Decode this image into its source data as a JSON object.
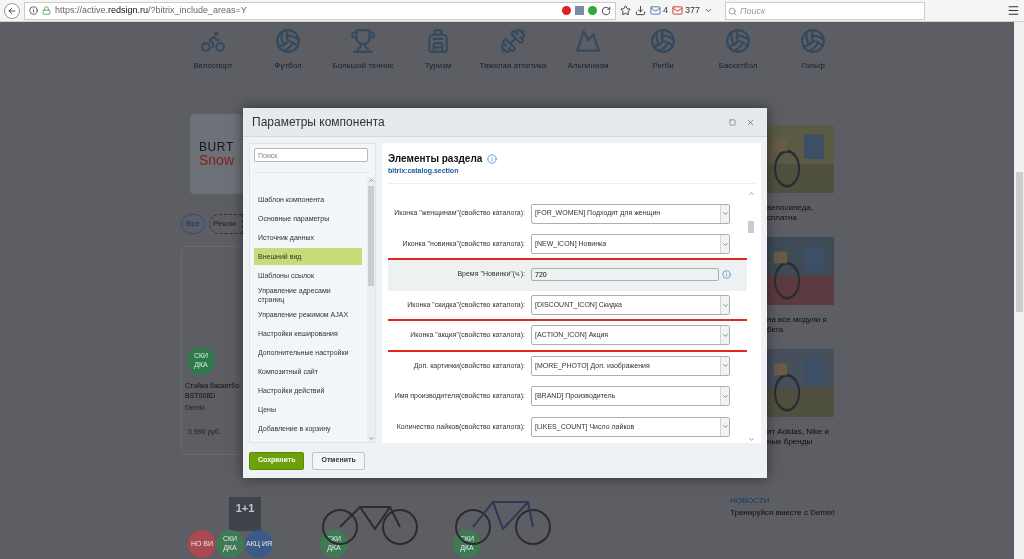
{
  "browser": {
    "url_host": "https://active.",
    "url_domain": "redsign.ru",
    "url_path": "/?bitrix_include_areas=Y",
    "mail_count": "4",
    "gmail_count": "377",
    "search_placeholder": "Поиск"
  },
  "categories": [
    {
      "label": "Велоспорт"
    },
    {
      "label": "Футбол"
    },
    {
      "label": "Большой теннис"
    },
    {
      "label": "Туризм"
    },
    {
      "label": "Тяжелая атлетика"
    },
    {
      "label": "Альпинизм"
    },
    {
      "label": "Регби"
    },
    {
      "label": "Баскетбол"
    },
    {
      "label": "Гольф"
    }
  ],
  "left_column": {
    "banner_line_1": "BURT",
    "banner_line_2": "Snow",
    "filter_all": "Все",
    "filter_other": "Реком",
    "badge": "СКИ ДКА",
    "product_name": "Стойка баскетбо BST008D",
    "product_brand": "Demix",
    "product_price": "3 990 руб."
  },
  "news": [
    {
      "text": "велосипеда, сплатна"
    },
    {
      "text": "на все модули я бега"
    },
    {
      "text": "ит Adidas, Nike и ные бренды"
    }
  ],
  "news_footer": {
    "heading": "НОВОСТИ",
    "text": "Тренируйся вместе с Demix!"
  },
  "bottom_badges": [
    {
      "text": "НО ВИ",
      "color": "#a84a4f"
    },
    {
      "text": "СКИ ДКА",
      "color": "#3f7a55"
    },
    {
      "text": "АКЦ ИЯ",
      "color": "#3d5a86"
    },
    {
      "text": "СКИ ДКА",
      "color": "#3f7a55"
    },
    {
      "text": "СКИ ДКА",
      "color": "#3f7a55"
    }
  ],
  "promo_badge": "1+1",
  "dialog": {
    "title": "Параметры компонента",
    "search_placeholder": "Поиск",
    "sidebar_items": [
      {
        "label": "Шаблон компонента",
        "selected": false
      },
      {
        "label": "Основные параметры",
        "selected": false
      },
      {
        "label": "Источник данных",
        "selected": false
      },
      {
        "label": "Внешний вид",
        "selected": true
      },
      {
        "label": "Шаблоны ссылок",
        "selected": false
      },
      {
        "label": "Управление адресами страниц",
        "selected": false
      },
      {
        "label": "Управление режимом AJAX",
        "selected": false
      },
      {
        "label": "Настройки кеширования",
        "selected": false
      },
      {
        "label": "Дополнительные настройки",
        "selected": false
      },
      {
        "label": "Композитный сайт",
        "selected": false
      },
      {
        "label": "Настройки действий",
        "selected": false
      },
      {
        "label": "Цены",
        "selected": false
      },
      {
        "label": "Добавление в корзину",
        "selected": false
      }
    ],
    "heading": "Элементы раздела",
    "component": "bitrix:catalog.section",
    "rows": [
      {
        "kind": "select",
        "label": "Иконка \"женщинам\"(свойство каталога):",
        "value": "[FOR_WOMEN] Подходит для женщин",
        "underlined": false,
        "highlighted": false
      },
      {
        "kind": "select",
        "label": "Иконка \"новинка\"(свойство каталога):",
        "value": "[NEW_ICON] Новинка",
        "underlined": true,
        "highlighted": false
      },
      {
        "kind": "input",
        "label": "Время \"Новинки\"(ч.):",
        "value": "720",
        "underlined": false,
        "highlighted": true
      },
      {
        "kind": "select",
        "label": "Иконка \"скидка\"(свойство каталога):",
        "value": "[DISCOUNT_ICON] Скидка",
        "underlined": true,
        "highlighted": false
      },
      {
        "kind": "select",
        "label": "Иконка \"акция\"(свойство каталога):",
        "value": "[ACTION_ICON] Акция",
        "underlined": true,
        "highlighted": false
      },
      {
        "kind": "select",
        "label": "Доп. картинки(свойство каталога):",
        "value": "[MORE_PHOTO] Доп. изображения",
        "underlined": false,
        "highlighted": false
      },
      {
        "kind": "select",
        "label": "Имя производителя(свойство каталога):",
        "value": "[BRAND] Производитель",
        "underlined": false,
        "highlighted": false
      },
      {
        "kind": "select",
        "label": "Количество лайков(свойство каталога):",
        "value": "[LIKES_COUNT] Число лайков",
        "underlined": false,
        "highlighted": false
      }
    ],
    "buttons": [
      {
        "kind": "primary",
        "label": "Сохранить"
      },
      {
        "kind": "secondary",
        "label": "Отменить"
      }
    ]
  }
}
